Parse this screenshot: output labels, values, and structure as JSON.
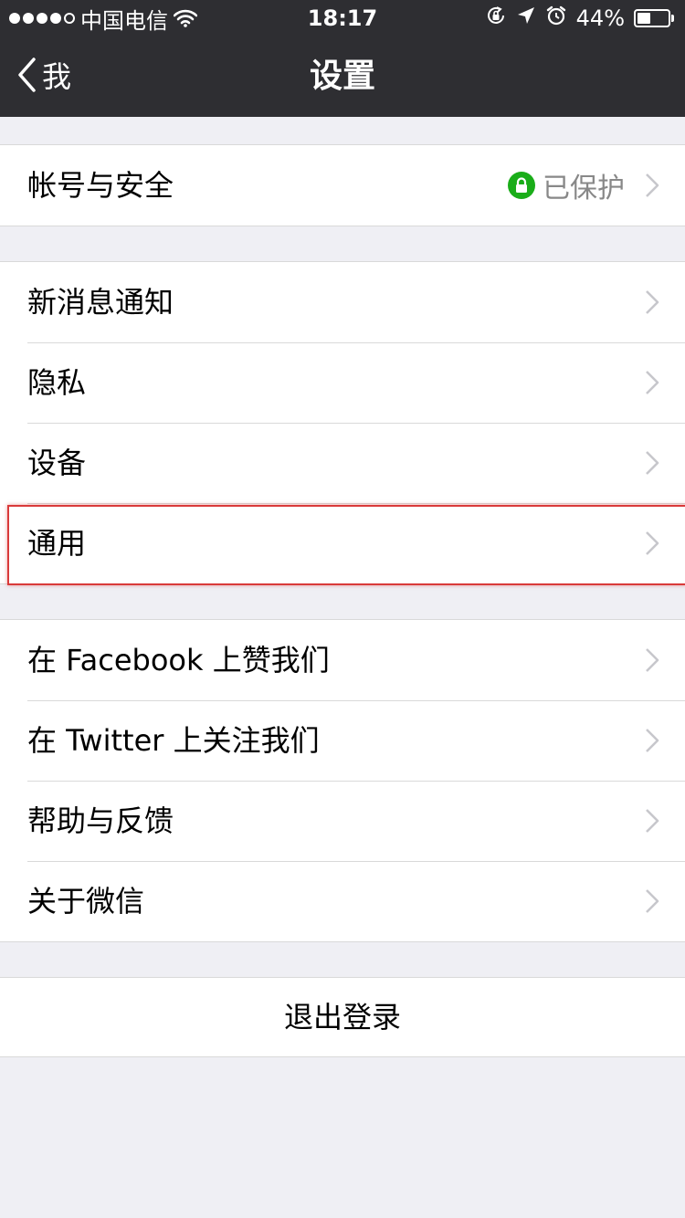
{
  "status_bar": {
    "carrier": "中国电信",
    "time": "18:17",
    "battery_percent_text": "44%",
    "battery_level": 0.44,
    "signal_strength": 4,
    "signal_max": 5
  },
  "nav": {
    "back_label": "我",
    "title": "设置"
  },
  "groups": {
    "account": {
      "label": "帐号与安全",
      "status": "已保护"
    },
    "general_group": {
      "items": [
        {
          "label": "新消息通知"
        },
        {
          "label": "隐私"
        },
        {
          "label": "设备"
        },
        {
          "label": "通用"
        }
      ]
    },
    "about_group": {
      "items": [
        {
          "label": "在 Facebook 上赞我们"
        },
        {
          "label": "在 Twitter 上关注我们"
        },
        {
          "label": "帮助与反馈"
        },
        {
          "label": "关于微信"
        }
      ]
    },
    "logout": {
      "label": "退出登录"
    }
  },
  "colors": {
    "bar_background": "#2e2e32",
    "page_background": "#efeff4",
    "secure_green": "#1aad19",
    "highlight_red": "#d93a3a"
  }
}
